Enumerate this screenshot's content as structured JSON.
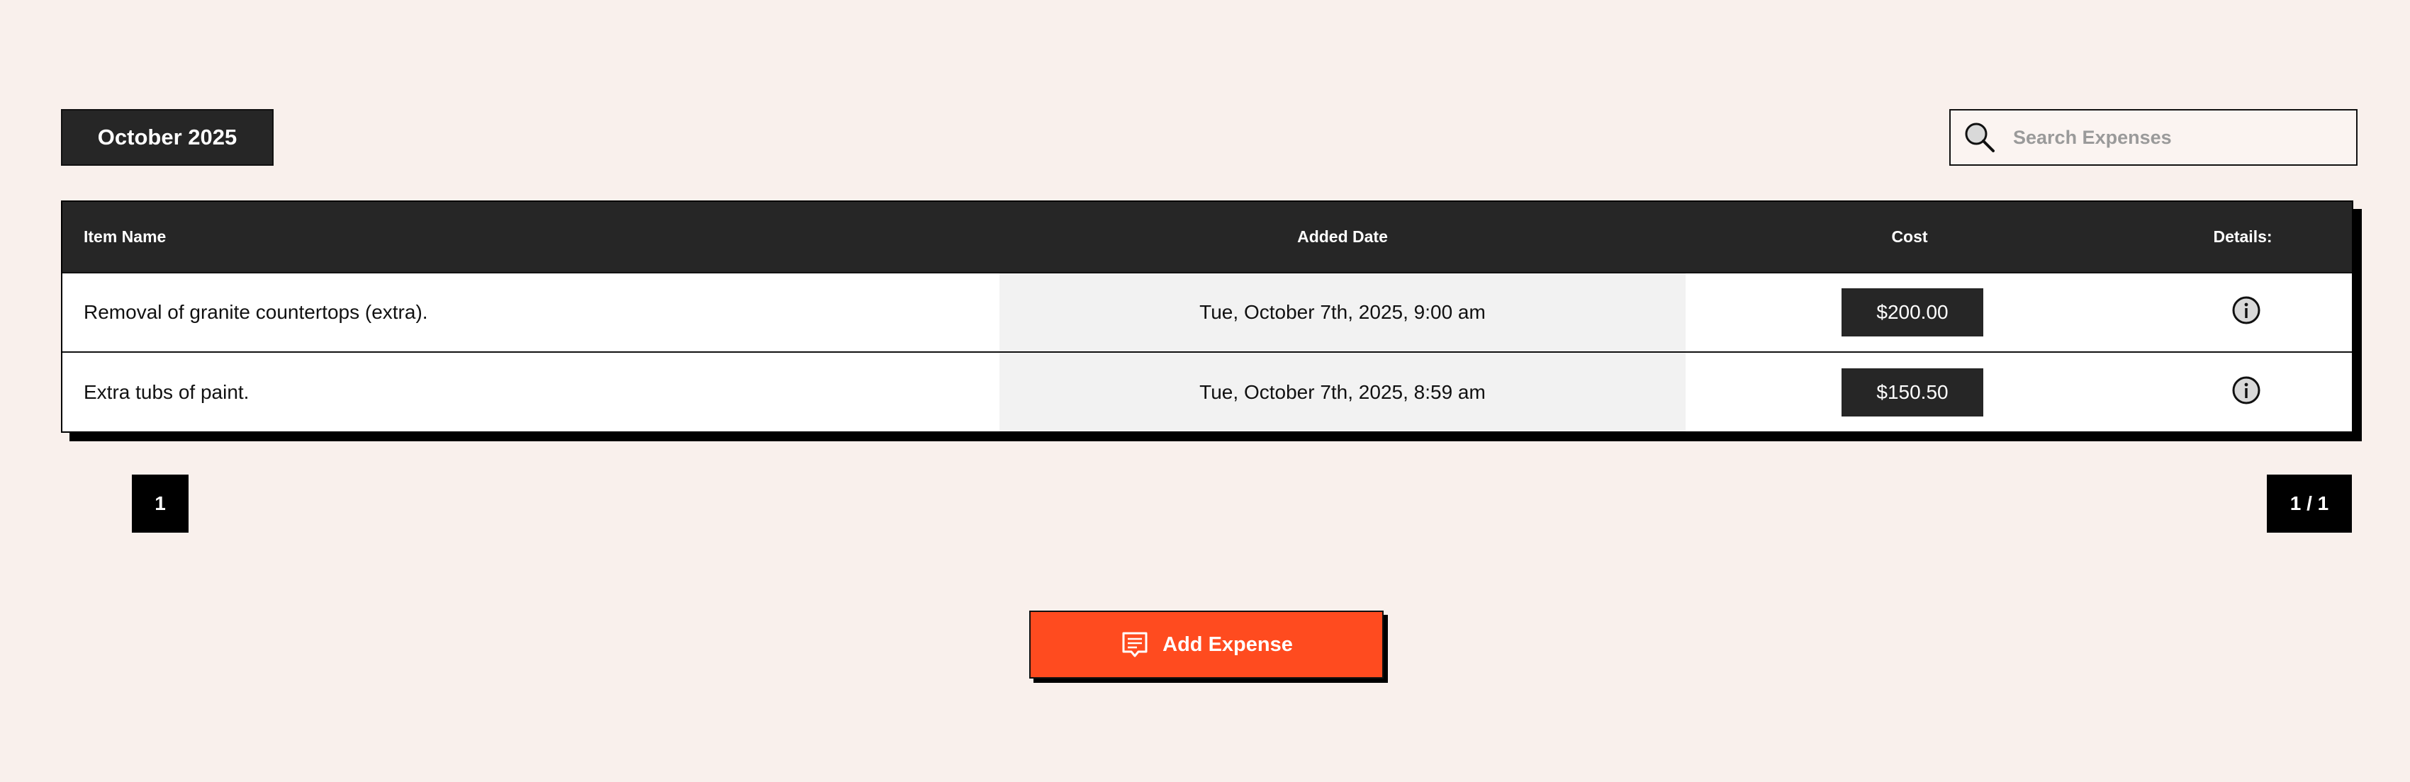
{
  "header": {
    "month_label": "October 2025"
  },
  "search": {
    "placeholder": "Search Expenses",
    "value": ""
  },
  "table": {
    "columns": {
      "name": "Item Name",
      "date": "Added Date",
      "cost": "Cost",
      "details": "Details:"
    },
    "rows": [
      {
        "name": "Removal of granite countertops (extra).",
        "date": "Tue, October 7th, 2025, 9:00 am",
        "cost": "$200.00"
      },
      {
        "name": "Extra tubs of paint.",
        "date": "Tue, October 7th, 2025, 8:59 am",
        "cost": "$150.50"
      }
    ]
  },
  "pagination": {
    "current_page": "1",
    "page_count": "1 / 1"
  },
  "actions": {
    "add_label": "Add Expense"
  },
  "icons": {
    "search": "search-icon",
    "info": "info-icon",
    "receipt": "receipt-icon"
  },
  "colors": {
    "background": "#f9f0ec",
    "dark": "#262626",
    "accent": "#ff4b1f"
  }
}
